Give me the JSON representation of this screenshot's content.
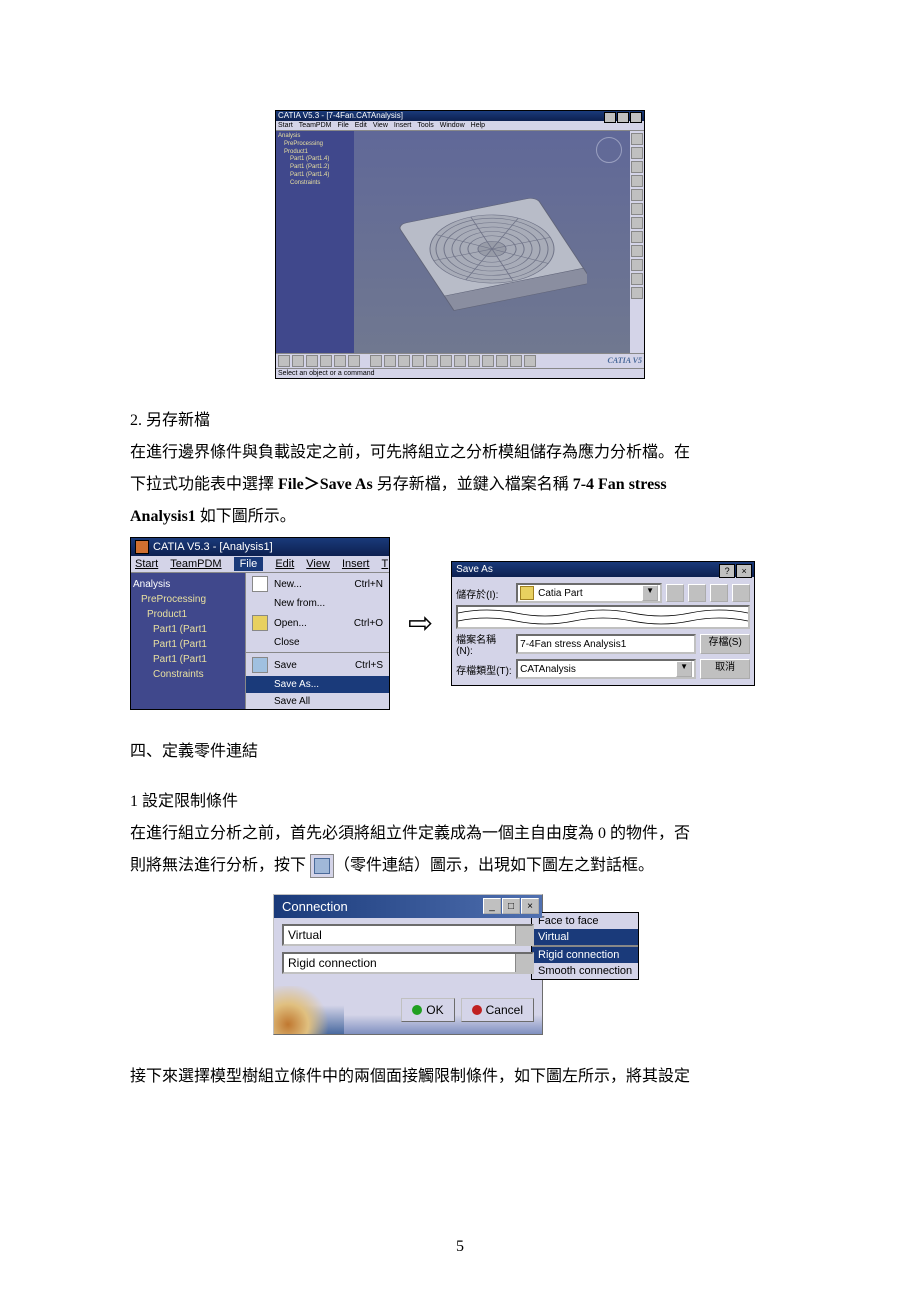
{
  "fig1": {
    "title": "CATIA V5.3 - [7-4Fan.CATAnalysis]",
    "menu": [
      "Start",
      "TeamPDM",
      "File",
      "Edit",
      "View",
      "Insert",
      "Tools",
      "Window",
      "Help"
    ],
    "tree": [
      "Analysis",
      "PreProcessing",
      "Product1",
      "Part1 (Part1.4)",
      "Part1 (Part1.2)",
      "Part1 (Part1.4)",
      "Constraints"
    ],
    "brand": "CATIA V5"
  },
  "para1_num": "2.  另存新檔",
  "para1_l1": "在進行邊界條件與負載設定之前，可先將組立之分析模組儲存為應力分析檔。在",
  "para1_l2a": "下拉式功能表中選擇 ",
  "para1_l2b": "File＞Save As",
  "para1_l2c": " 另存新檔，並鍵入檔案名稱 ",
  "para1_l2d": "7-4 Fan stress",
  "para1_l3a": "Analysis1",
  "para1_l3b": " 如下圖所示。",
  "fig2": {
    "panelA": {
      "title": "CATIA V5.3 - [Analysis1]",
      "menu": {
        "start": "Start",
        "teampdm": "TeamPDM",
        "file": "File",
        "edit": "Edit",
        "view": "View",
        "insert": "Insert",
        "t": "T"
      },
      "tree": [
        "Analysis",
        "PreProcessing",
        "Product1",
        "Part1 (Part1",
        "Part1 (Part1",
        "Part1 (Part1",
        "Constraints"
      ],
      "menuItems": [
        {
          "label": "New...",
          "shortcut": "Ctrl+N"
        },
        {
          "label": "New from..."
        },
        {
          "label": "Open...",
          "shortcut": "Ctrl+O"
        },
        {
          "label": "Close"
        },
        {
          "label": "Save",
          "shortcut": "Ctrl+S"
        },
        {
          "label": "Save As..."
        },
        {
          "label": "Save All"
        }
      ]
    },
    "saveAs": {
      "title": "Save As",
      "storeIn_lbl": "儲存於(I):",
      "storeIn_val": "Catia Part",
      "filename_lbl": "檔案名稱(N):",
      "filename_val": "7-4Fan stress Analysis1",
      "filetype_lbl": "存檔類型(T):",
      "filetype_val": "CATAnalysis",
      "save_btn": "存檔(S)",
      "cancel_btn": "取消"
    }
  },
  "heading2": "四、定義零件連結",
  "para2_head": "1 設定限制條件",
  "para2_l1": "在進行組立分析之前，首先必須將組立件定義成為一個主自由度為 0 的物件，否",
  "para2_l2a": "則將無法進行分析，按下 ",
  "para2_l2b": "（零件連結）圖示，出現如下圖左之對話框。",
  "fig3": {
    "conn_title": "Connection",
    "combo1": "Virtual",
    "combo2": "Rigid connection",
    "ok": "OK",
    "cancel": "Cancel",
    "pop": [
      "Face to face",
      "Virtual",
      "Rigid connection",
      "Smooth connection"
    ]
  },
  "para3": "接下來選擇模型樹組立條件中的兩個面接觸限制條件，如下圖左所示，將其設定",
  "page_num": "5"
}
